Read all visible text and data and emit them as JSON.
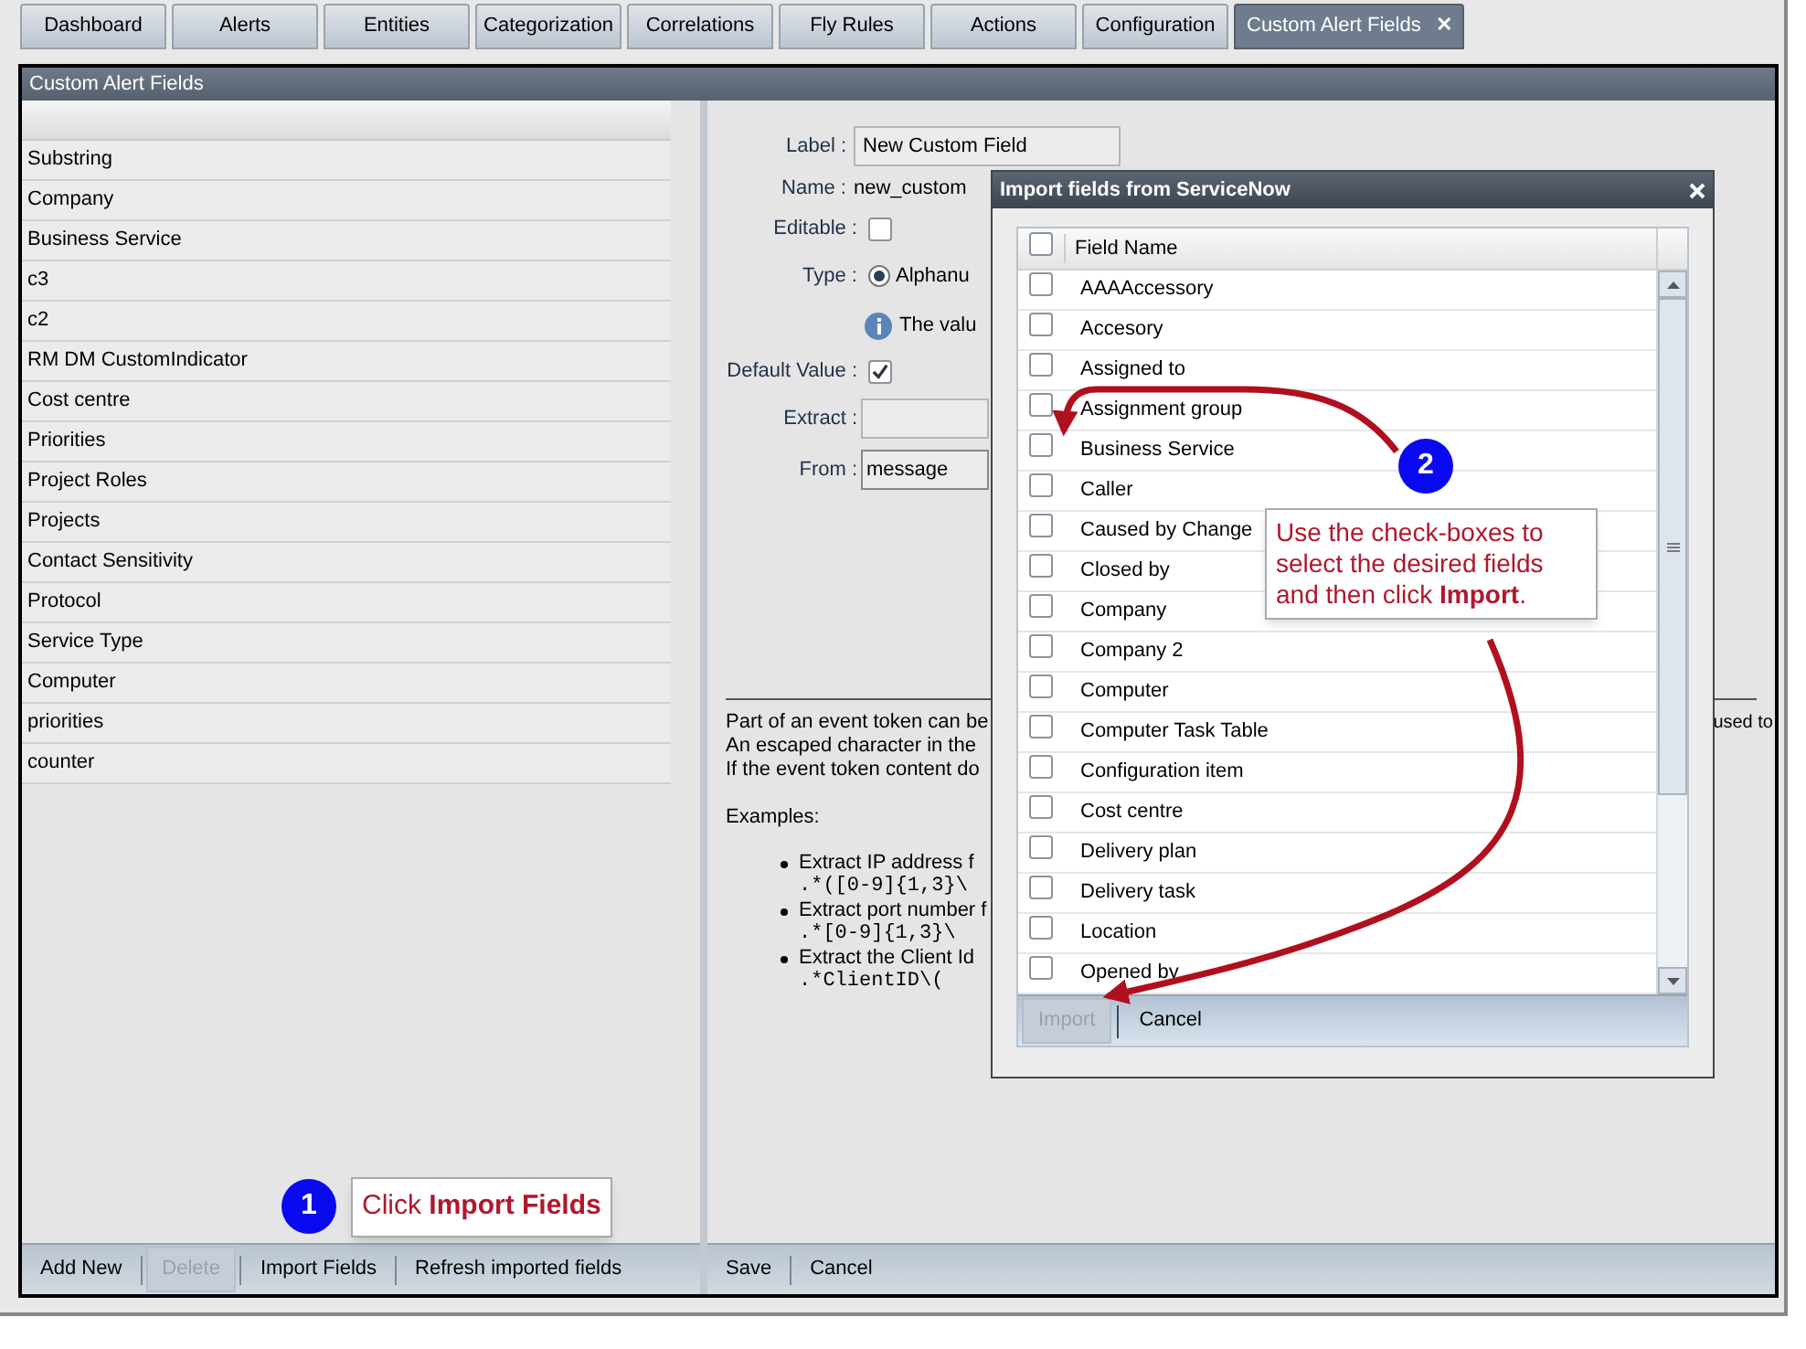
{
  "tabs": [
    {
      "label": "Dashboard",
      "selected": false
    },
    {
      "label": "Alerts",
      "selected": false
    },
    {
      "label": "Entities",
      "selected": false
    },
    {
      "label": "Categorization",
      "selected": false
    },
    {
      "label": "Correlations",
      "selected": false
    },
    {
      "label": "Fly Rules",
      "selected": false
    },
    {
      "label": "Actions",
      "selected": false
    },
    {
      "label": "Configuration",
      "selected": false
    },
    {
      "label": "Custom Alert Fields",
      "selected": true,
      "close": "✕"
    }
  ],
  "panel": {
    "title": "Custom Alert Fields"
  },
  "field_list": {
    "items": [
      "Substring",
      "Company",
      "Business Service",
      "c3",
      "c2",
      "RM DM CustomIndicator",
      "Cost centre",
      "Priorities",
      "Project Roles",
      "Projects",
      "Contact Sensitivity",
      "Protocol",
      "Service Type",
      "Computer",
      "priorities",
      "counter"
    ],
    "buttons": [
      {
        "label": "Add New",
        "disabled": false
      },
      {
        "label": "Delete",
        "disabled": true
      },
      {
        "label": "Import Fields",
        "disabled": false
      },
      {
        "label": "Refresh imported fields",
        "disabled": false
      }
    ]
  },
  "form": {
    "label": {
      "label": "Label :",
      "value": "New Custom Field"
    },
    "name": {
      "label": "Name :",
      "value": "new_custom"
    },
    "editable": {
      "label": "Editable :",
      "checked": false
    },
    "type": {
      "label": "Type :",
      "option": "Alphanu",
      "selected": true
    },
    "info": "The valu",
    "default_value": {
      "label": "Default Value :",
      "checked": true
    },
    "extract": {
      "label": "Extract :"
    },
    "from": {
      "label": "From :",
      "value": "message"
    },
    "help_lines": [
      "Part of an event token can be",
      "An escaped character in the",
      "If the event token content do"
    ],
    "help_right": "used to",
    "examples_title": "Examples:",
    "examples": [
      {
        "text": "Extract IP address f",
        "code": ".*([0-9]{1,3}\\"
      },
      {
        "text": "Extract port number f",
        "code": ".*[0-9]{1,3}\\"
      },
      {
        "text": "Extract the Client Id",
        "code": ".*ClientID\\("
      }
    ],
    "buttons": [
      "Save",
      "Cancel"
    ]
  },
  "dialog": {
    "title": "Import fields from ServiceNow",
    "column": "Field Name",
    "header_checked": false,
    "rows": [
      {
        "name": "AAAAccessory",
        "checked": false
      },
      {
        "name": "Accesory",
        "checked": false
      },
      {
        "name": "Assigned to",
        "checked": false
      },
      {
        "name": "Assignment group",
        "checked": false
      },
      {
        "name": "Business Service",
        "checked": false
      },
      {
        "name": "Caller",
        "checked": false
      },
      {
        "name": "Caused by Change",
        "checked": false
      },
      {
        "name": "Closed by",
        "checked": false
      },
      {
        "name": "Company",
        "checked": false
      },
      {
        "name": "Company 2",
        "checked": false
      },
      {
        "name": "Computer",
        "checked": false
      },
      {
        "name": "Computer Task Table",
        "checked": false
      },
      {
        "name": "Configuration item",
        "checked": false
      },
      {
        "name": "Cost centre",
        "checked": false
      },
      {
        "name": "Delivery plan",
        "checked": false
      },
      {
        "name": "Delivery task",
        "checked": false
      },
      {
        "name": "Location",
        "checked": false
      },
      {
        "name": "Opened by",
        "checked": false
      }
    ],
    "buttons": [
      {
        "label": "Import",
        "disabled": true
      },
      {
        "label": "Cancel",
        "disabled": false
      }
    ]
  },
  "callouts": [
    {
      "number": "1",
      "text": "Click **Import Fields**"
    },
    {
      "number": "2",
      "text": "Use the check-boxes to select the desired fields and then click **Import**."
    }
  ]
}
